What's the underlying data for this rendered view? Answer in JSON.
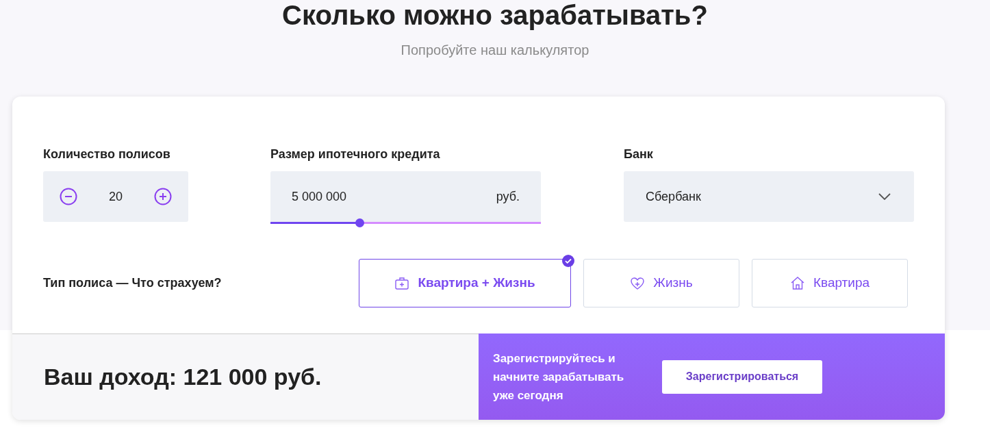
{
  "heading": "Сколько можно зарабатывать?",
  "subheading": "Попробуйте наш калькулятор",
  "policies_count": {
    "label": "Количество полисов",
    "value": "20"
  },
  "loan": {
    "label": "Размер ипотечного кредита",
    "value": "5 000 000",
    "unit": "руб.",
    "level": 0.33
  },
  "bank": {
    "label": "Банк",
    "value": "Сбербанк"
  },
  "policy_type": {
    "label": "Тип полиса — Что страхуем?",
    "options": [
      {
        "kind": "apartment_life",
        "label": "Квартира + Жизнь",
        "selected": true
      },
      {
        "kind": "life",
        "label": "Жизнь",
        "selected": false
      },
      {
        "kind": "apartment",
        "label": "Квартира",
        "selected": false
      }
    ]
  },
  "income": "Ваш доход: 121 000 руб.",
  "cta": {
    "text": "Зарегистрируйтесь и начните зарабатывать уже сегодня",
    "button": "Зарегистрироваться"
  }
}
